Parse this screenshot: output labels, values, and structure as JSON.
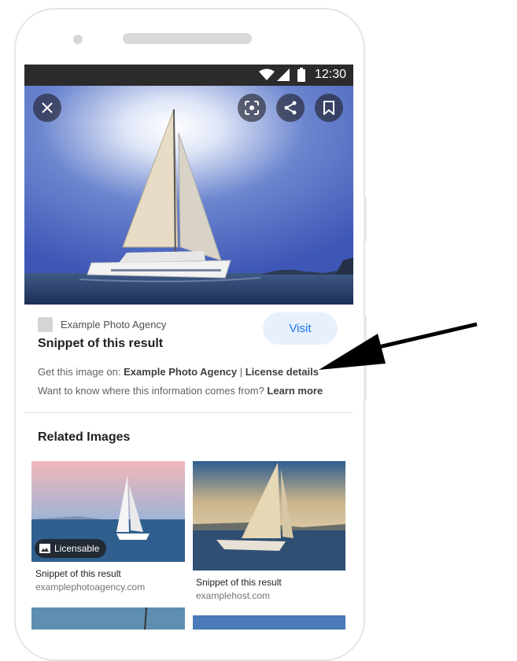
{
  "statusbar": {
    "time": "12:30"
  },
  "hero": {
    "actions": [
      "close",
      "lens",
      "share",
      "bookmark"
    ]
  },
  "result": {
    "source_name": "Example Photo Agency",
    "title": "Snippet of this result",
    "visit_label": "Visit",
    "get_image_prefix": "Get this image on: ",
    "get_image_source": "Example Photo Agency",
    "separator": " | ",
    "license_link": "License details",
    "learn_prefix": "Want to know where this information comes from? ",
    "learn_link": "Learn more"
  },
  "related": {
    "title": "Related Images",
    "items": [
      {
        "caption": "Snippet of this result",
        "source": "examplephotoagency.com",
        "badge": "Licensable"
      },
      {
        "caption": "Snippet of this result",
        "source": "examplehost.com"
      }
    ]
  },
  "colors": {
    "link_blue": "#1a73e8",
    "visit_bg": "#e8f0fe",
    "status_bar": "#2b2b2b"
  }
}
